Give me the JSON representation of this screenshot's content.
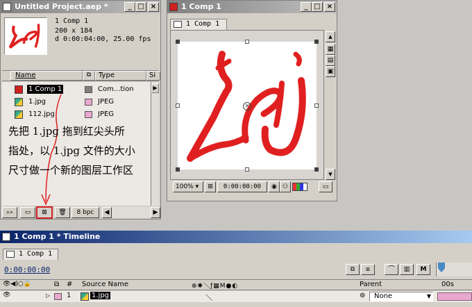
{
  "project": {
    "title": "Untitled Project.aep *",
    "thumb_name": "1 Comp 1",
    "thumb_dims": "200 x 184",
    "thumb_duration": "d 0:00:04:00, 25.00 fps",
    "col_name": "Name",
    "col_type": "Type",
    "col_size": "Si",
    "items": [
      {
        "name": "1 Comp 1",
        "type": "Com...tion",
        "color": "#808080"
      },
      {
        "name": "1.jpg",
        "type": "JPEG",
        "color": "#e8a8d0"
      },
      {
        "name": "112.jpg",
        "type": "JPEG",
        "color": "#e8a8d0"
      }
    ],
    "bpc": "8 bpc"
  },
  "annotation": {
    "line1": "先把 1.jpg 拖到红尖头所",
    "line2": "指处，以 1.jpg 文件的大小",
    "line3": "尺寸做一个新的图层工作区"
  },
  "comp": {
    "title": "1 Comp 1",
    "tab": "1 Comp 1",
    "zoom": "100%",
    "timecode": "0:00:00:00"
  },
  "timeline": {
    "title": "1 Comp 1 * Timeline",
    "tab": "1 Comp 1",
    "timecode": "0:00:00:00",
    "col_num": "#",
    "col_source": "Source Name",
    "col_parent": "Parent",
    "ruler_start": "00s",
    "layer": {
      "num": "1",
      "name": "1.jpg",
      "parent": "None",
      "color": "#e8a8d0"
    }
  },
  "colors": {
    "accent": "#0a246a",
    "logo_red": "#e02020"
  }
}
